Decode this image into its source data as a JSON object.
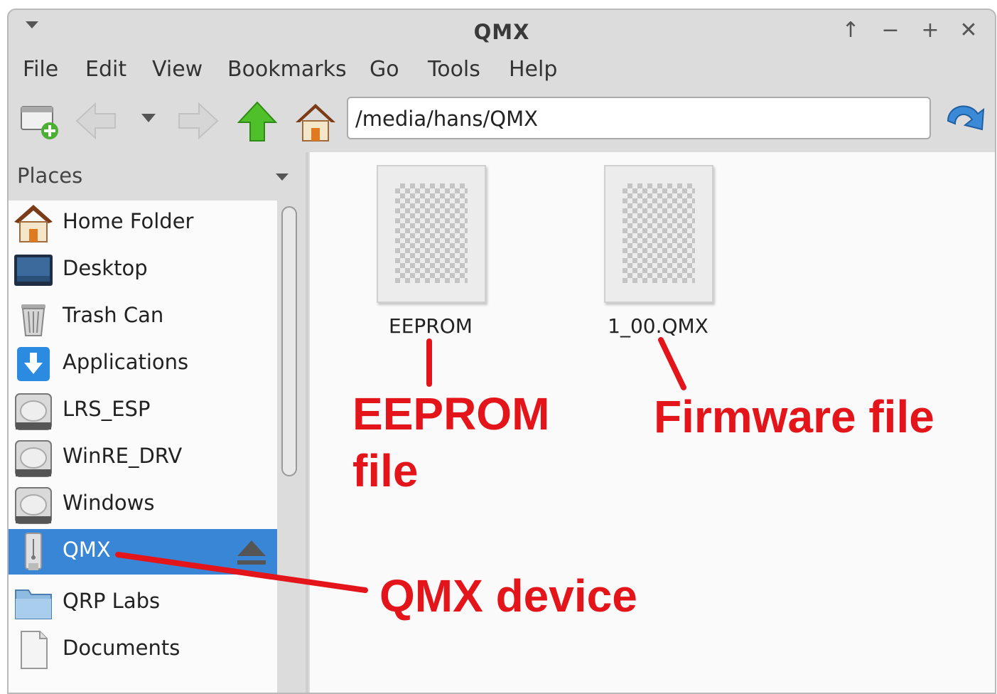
{
  "window": {
    "title": "QMX"
  },
  "menubar": [
    "File",
    "Edit",
    "View",
    "Bookmarks",
    "Go",
    "Tools",
    "Help"
  ],
  "toolbar": {
    "location": "/media/hans/QMX"
  },
  "sidebar": {
    "header": "Places",
    "items": [
      {
        "label": "Home Folder",
        "icon": "home-icon"
      },
      {
        "label": "Desktop",
        "icon": "desktop-icon"
      },
      {
        "label": "Trash Can",
        "icon": "trash-icon"
      },
      {
        "label": "Applications",
        "icon": "applications-icon"
      },
      {
        "label": "LRS_ESP",
        "icon": "drive-icon"
      },
      {
        "label": "WinRE_DRV",
        "icon": "drive-icon"
      },
      {
        "label": "Windows",
        "icon": "drive-icon"
      },
      {
        "label": "QMX",
        "icon": "usb-drive-icon",
        "selected": true
      },
      {
        "label": "QRP Labs",
        "icon": "folder-icon"
      },
      {
        "label": "Documents",
        "icon": "document-icon"
      }
    ]
  },
  "files": [
    {
      "name": "EEPROM"
    },
    {
      "name": "1_00.QMX"
    }
  ],
  "annotations": {
    "eeprom_line1": "EEPROM",
    "eeprom_line2": "file",
    "firmware": "Firmware file",
    "device": "QMX device",
    "color": "#e4151a"
  },
  "colors": {
    "selection": "#3a86d6",
    "accent_red": "#e4151a"
  }
}
